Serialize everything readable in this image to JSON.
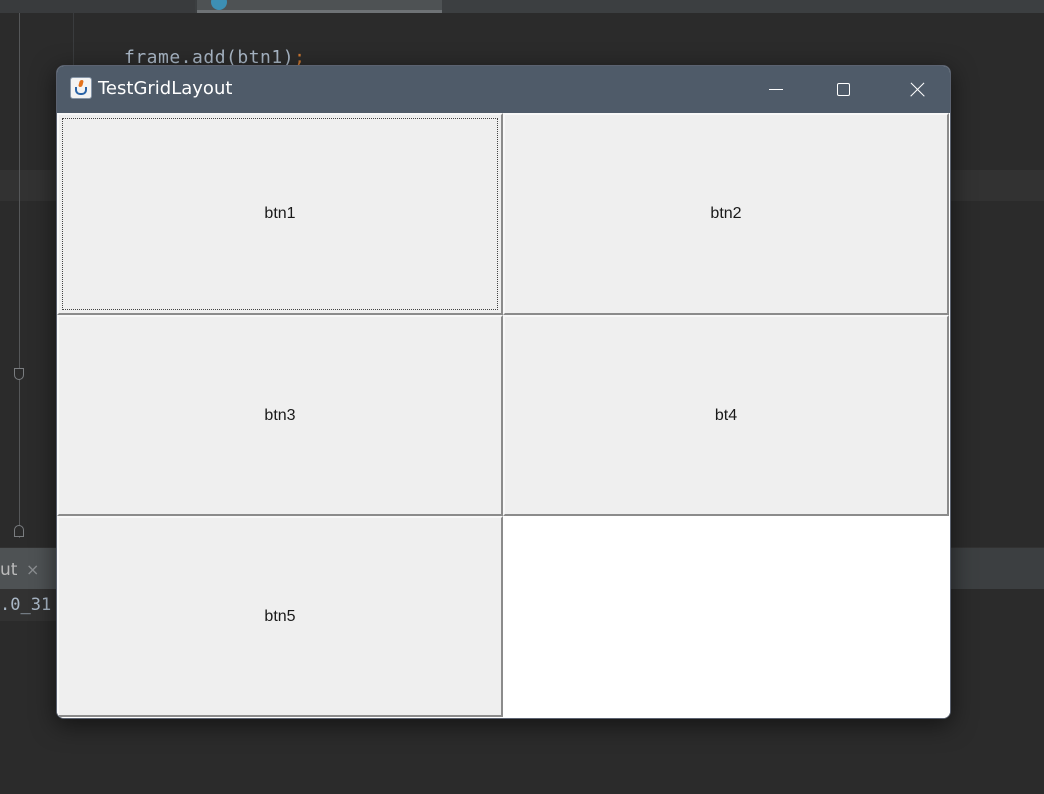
{
  "ide": {
    "code_line": "frame.add(btn1)",
    "code_semicolon": ";",
    "run_tab_label": "ut",
    "run_tab_close": "×",
    "run_output": ".0_31"
  },
  "window": {
    "title": "TestGridLayout",
    "controls": {
      "minimize": "minimize",
      "maximize": "maximize",
      "close": "close"
    }
  },
  "grid": {
    "rows": 3,
    "cols": 2,
    "buttons": [
      {
        "label": "btn1",
        "focused": true
      },
      {
        "label": "btn2",
        "focused": false
      },
      {
        "label": "btn3",
        "focused": false
      },
      {
        "label": "bt4",
        "focused": false
      },
      {
        "label": "btn5",
        "focused": false
      }
    ]
  },
  "colors": {
    "titlebar": "#4f5b69",
    "button_face": "#efefef",
    "ide_background": "#2b2b2b"
  }
}
